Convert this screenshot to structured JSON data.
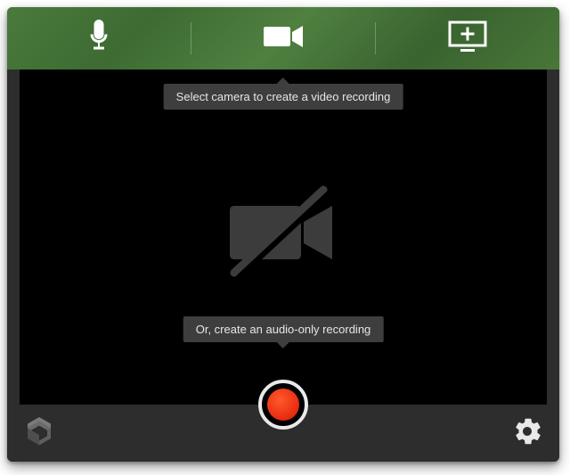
{
  "tabs": {
    "mic_name": "microphone",
    "camera_name": "camera",
    "screen_name": "screen-add"
  },
  "tooltip_top": "Select camera to create a video recording",
  "tooltip_bottom": "Or, create an audio-only recording",
  "colors": {
    "header_green": "#447536",
    "record_red": "#ed3b16"
  }
}
